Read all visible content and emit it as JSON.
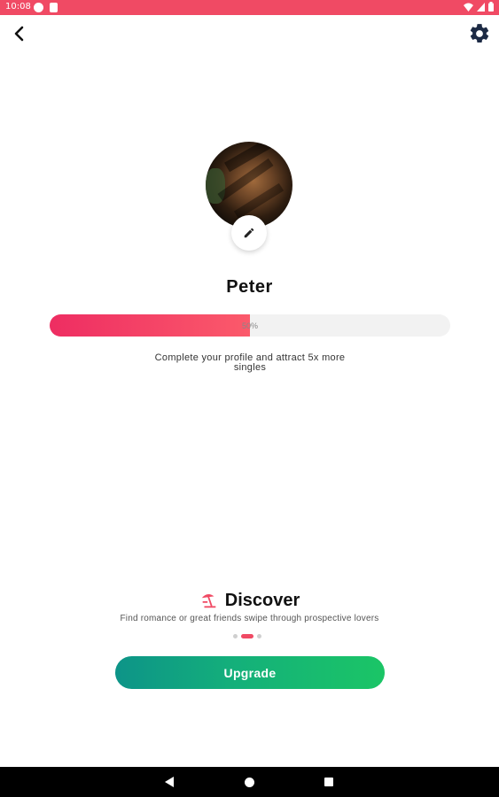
{
  "status_bar": {
    "time": "10:08",
    "background": "#f04a64",
    "icons": [
      "app-notification-icon",
      "sim-card-icon",
      "wifi-icon",
      "signal-icon",
      "battery-icon"
    ]
  },
  "header": {
    "back_icon": "chevron-left-icon",
    "settings_icon": "gear-icon"
  },
  "profile": {
    "name": "Peter",
    "edit_icon": "pencil-icon",
    "completion_percent": 50,
    "completion_label": "50%",
    "hint": "Complete your profile and attract 5x more singles"
  },
  "promo": {
    "icon": "beach-umbrella-icon",
    "title": "Discover",
    "description": "Find romance or great friends swipe through prospective lovers",
    "pages": 3,
    "active_page": 2
  },
  "cta": {
    "upgrade_label": "Upgrade"
  },
  "colors": {
    "accent": "#f04a64",
    "upgrade_start": "#0d9488",
    "upgrade_end": "#1bc566"
  },
  "nav_bar": {
    "icons": [
      "nav-back-icon",
      "nav-home-icon",
      "nav-recents-icon"
    ]
  }
}
